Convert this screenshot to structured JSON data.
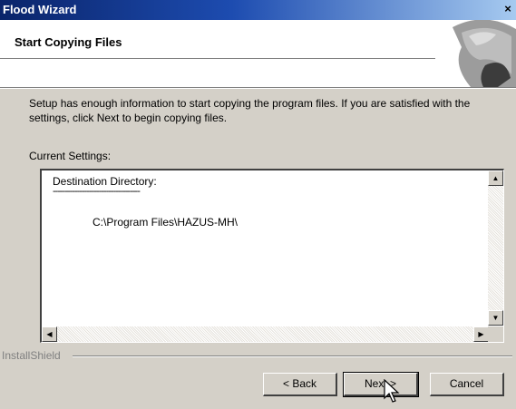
{
  "window": {
    "title": "Flood Wizard",
    "close_glyph": "×"
  },
  "header": {
    "subtitle": "Start Copying Files"
  },
  "body": {
    "intro": "Setup has enough information to start copying the program files.  If you are satisfied with the settings, click Next to begin copying files.",
    "current_settings_label": "Current Settings:"
  },
  "settings": {
    "destination_label": "Destination Directory:",
    "separator": "------------------------------------",
    "destination_path": "C:\\Program Files\\HAZUS-MH\\"
  },
  "footer": {
    "brand": "InstallShield"
  },
  "buttons": {
    "back": "< Back",
    "next": "Next >",
    "cancel": "Cancel"
  }
}
